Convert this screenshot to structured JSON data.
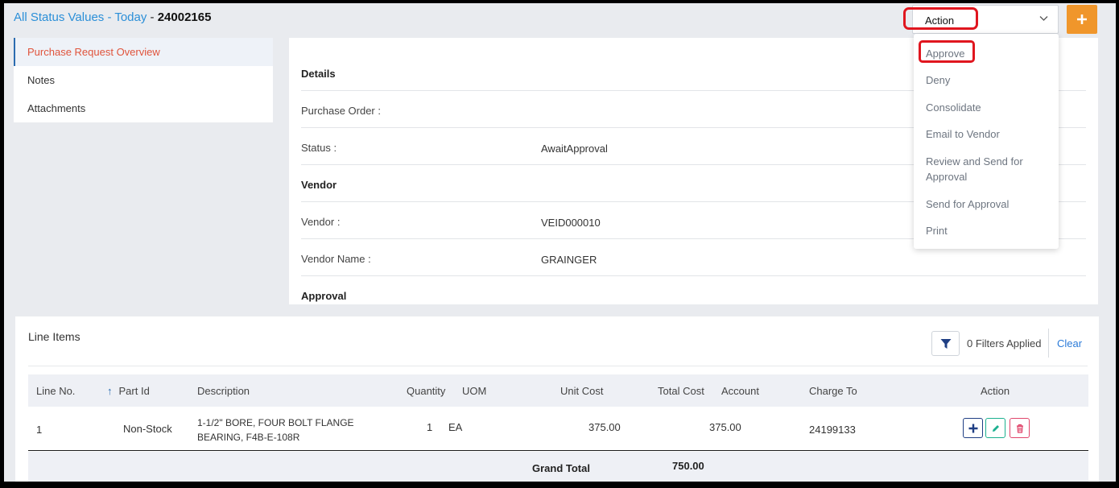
{
  "header": {
    "title_link": "All Status Values - Today",
    "title_sep": " - ",
    "record_id": "24002165",
    "action_select": {
      "value": "Action"
    }
  },
  "sidebar": {
    "items": [
      {
        "label": "Purchase Request Overview",
        "active": true
      },
      {
        "label": "Notes"
      },
      {
        "label": "Attachments"
      }
    ]
  },
  "details": {
    "sections": {
      "details": "Details",
      "vendor": "Vendor",
      "approval": "Approval"
    },
    "fields": {
      "purchase_order": {
        "label": "Purchase Order :",
        "value": ""
      },
      "status": {
        "label": "Status :",
        "value": "AwaitApproval"
      },
      "vendor": {
        "label": "Vendor :",
        "value": "VEID000010"
      },
      "vendor_name": {
        "label": "Vendor Name :",
        "value": "GRAINGER"
      }
    }
  },
  "action_menu": {
    "items": [
      "Approve",
      "Deny",
      "Consolidate",
      "Email to Vendor",
      "Review and Send for Approval",
      "Send for Approval",
      "Print"
    ]
  },
  "line_items": {
    "title": "Line Items",
    "filters_applied": "0 Filters Applied",
    "clear_label": "Clear",
    "columns": [
      "Line No.",
      "Part Id",
      "Description",
      "Quantity",
      "UOM",
      "Unit Cost",
      "Total Cost",
      "Account",
      "Charge To",
      "Action"
    ],
    "rows": [
      {
        "line_no": "1",
        "part_id": "Non-Stock",
        "description_line1": "1-1/2\" BORE, FOUR BOLT FLANGE",
        "description_line2": "BEARING, F4B-E-108R",
        "quantity": "1",
        "uom": "EA",
        "unit_cost": "375.00",
        "total_cost": "375.00",
        "account": "",
        "charge_to": "24199133"
      }
    ],
    "grand_total_label": "Grand Total",
    "grand_total_value": "750.00"
  },
  "colors": {
    "accent": "#2b8fd8",
    "active_text": "#e0543c",
    "highlight": "#e0161f",
    "plus_button": "#f0962b",
    "edit_icon": "#1bb08f",
    "delete_icon": "#e0456b",
    "add_icon": "#1f3f84"
  }
}
